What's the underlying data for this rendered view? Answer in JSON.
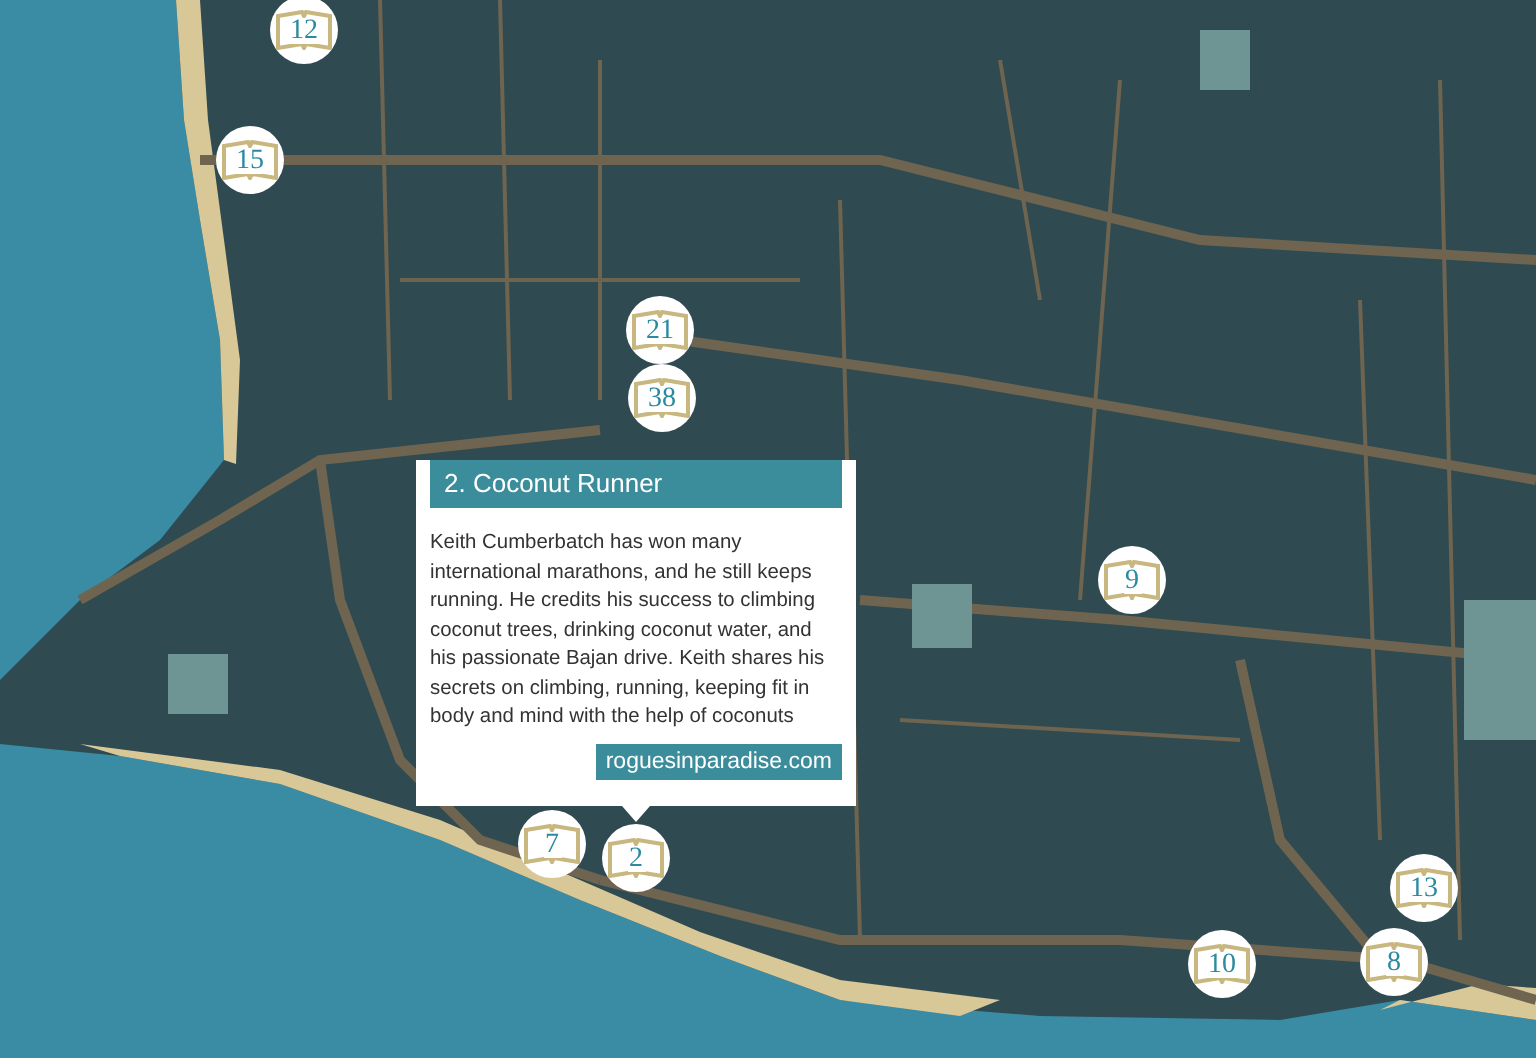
{
  "markers": [
    {
      "number": "12"
    },
    {
      "number": "15"
    },
    {
      "number": "21"
    },
    {
      "number": "38"
    },
    {
      "number": "9"
    },
    {
      "number": "7"
    },
    {
      "number": "2"
    },
    {
      "number": "10"
    },
    {
      "number": "13"
    },
    {
      "number": "8"
    }
  ],
  "popup": {
    "title": "2. Coconut Runner",
    "text": "Keith Cumberbatch has won many international marathons, and he still keeps running. He credits his success to climbing coconut trees, drinking coconut water, and his passionate Bajan drive. Keith shares his secrets on climbing, running, keeping fit in body and mind with the help of coconuts",
    "link": "roguesinparadise.com"
  }
}
